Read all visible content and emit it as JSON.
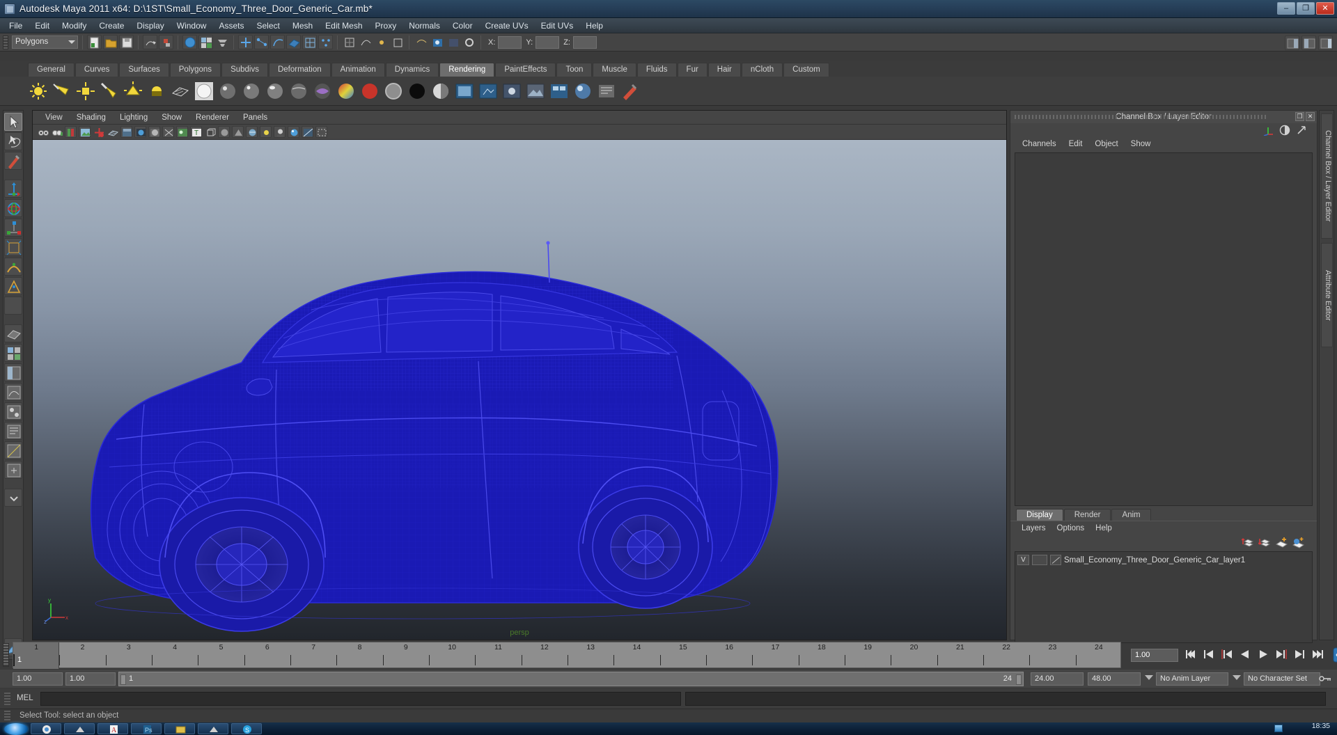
{
  "window": {
    "title": "Autodesk Maya 2011 x64: D:\\1ST\\Small_Economy_Three_Door_Generic_Car.mb*",
    "minimize": "–",
    "maximize": "❐",
    "close": "✕"
  },
  "menubar": {
    "items": [
      "File",
      "Edit",
      "Modify",
      "Create",
      "Display",
      "Window",
      "Assets",
      "Select",
      "Mesh",
      "Edit Mesh",
      "Proxy",
      "Normals",
      "Color",
      "Create UVs",
      "Edit UVs",
      "Help"
    ]
  },
  "statusline": {
    "mode": "Polygons",
    "x_label": "X:",
    "y_label": "Y:",
    "z_label": "Z:",
    "x_value": "",
    "y_value": "",
    "z_value": ""
  },
  "shelf": {
    "tabs": [
      "General",
      "Curves",
      "Surfaces",
      "Polygons",
      "Subdivs",
      "Deformation",
      "Animation",
      "Dynamics",
      "Rendering",
      "PaintEffects",
      "Toon",
      "Muscle",
      "Fluids",
      "Fur",
      "Hair",
      "nCloth",
      "Custom"
    ],
    "active_tab": "Rendering",
    "icons": [
      "ambient-light-icon",
      "directional-light-icon",
      "point-light-icon",
      "spot-light-icon",
      "area-light-icon",
      "volume-light-icon",
      "plane-light-icon",
      "lambert-material-icon",
      "blinn-material-icon",
      "phong-material-icon",
      "phonge-material-icon",
      "anisotropic-material-icon",
      "layered-shader-icon",
      "ramp-shader-icon",
      "surface-shader-icon",
      "use-background-icon",
      "black-shader-icon",
      "shading-map-icon",
      "render-current-frame-icon",
      "ipr-render-icon",
      "render-settings-icon",
      "render-view-icon",
      "batch-render-icon",
      "hypershade-icon",
      "rendering-flags-icon",
      "paint-icon"
    ]
  },
  "toolbox": {
    "tools": [
      "select-tool",
      "lasso-select-tool",
      "paint-select-tool",
      "move-tool",
      "rotate-tool",
      "scale-tool",
      "universal-manipulator-tool",
      "soft-modification-tool",
      "show-manipulator-tool",
      "last-tool-used",
      "quick-layout-single-icon",
      "quick-layout-four-icon",
      "quick-layout-persp-outliner-icon",
      "quick-layout-persp-graph-icon",
      "quick-layout-hypershade-icon",
      "quick-layout-outliner-icon",
      "quick-layout-uv-icon",
      "quick-layout-more-icon",
      "paint-effects-icon"
    ],
    "selected": "select-tool"
  },
  "viewport": {
    "menus": [
      "View",
      "Shading",
      "Lighting",
      "Show",
      "Renderer",
      "Panels"
    ],
    "icons": [
      "select-camera-icon",
      "lock-camera-icon",
      "bookmark-icon",
      "image-plane-icon",
      "keyframe-icon",
      "grid-icon",
      "film-gate-icon",
      "resolution-gate-icon",
      "gate-mask-icon",
      "xray-icon",
      "shadows-icon",
      "text-overlay-icon",
      "wireframe-icon",
      "smooth-shade-icon",
      "flat-shade-icon",
      "hardware-texture-icon",
      "light-icon",
      "shadow-icon",
      "hq-render-icon",
      "exposure-icon",
      "isolate-select-icon"
    ],
    "camera_label": "persp",
    "object_name": "Small_Economy_Three_Door_Generic_Car",
    "wireframe_color": "#1a1ab4",
    "axis": {
      "x": "x",
      "y": "y",
      "z": "z"
    }
  },
  "channelbox": {
    "title": "Channel Box / Layer Editor",
    "restore": "❐",
    "close": "✕",
    "menus": [
      "Channels",
      "Edit",
      "Object",
      "Show"
    ],
    "corner_icons": [
      "axis-toggle-icon",
      "channelbox-toggle-icon",
      "attribute-editor-icon"
    ],
    "content": ""
  },
  "layereditor": {
    "tabs": [
      "Display",
      "Render",
      "Anim"
    ],
    "active_tab": "Display",
    "menus": [
      "Layers",
      "Options",
      "Help"
    ],
    "buttons": [
      "move-layer-up-icon",
      "move-layer-down-icon",
      "new-layer-icon",
      "new-layer-from-selected-icon"
    ],
    "layers": [
      {
        "visible": "V",
        "state": "",
        "name": "Small_Economy_Three_Door_Generic_Car_layer1"
      }
    ]
  },
  "right_vtabs": [
    "Channel Box / Layer Editor",
    "Attribute Editor"
  ],
  "timeline": {
    "ticks": [
      "1",
      "2",
      "3",
      "4",
      "5",
      "6",
      "7",
      "8",
      "9",
      "10",
      "11",
      "12",
      "13",
      "14",
      "15",
      "16",
      "17",
      "18",
      "19",
      "20",
      "21",
      "22",
      "23",
      "24"
    ],
    "current_frame_marker": "1",
    "current_frame": "1.00"
  },
  "playback": {
    "buttons": [
      "go-to-start-icon",
      "step-back-frame-icon",
      "step-back-key-icon",
      "play-backwards-icon",
      "play-forwards-icon",
      "step-forward-key-icon",
      "step-forward-frame-icon",
      "go-to-end-icon"
    ],
    "auto_key_icon": "auto-key-icon",
    "anim_prefs_icon": "animation-preferences-icon"
  },
  "range": {
    "anim_start": "1.00",
    "range_start": "1.00",
    "bar_start": "1",
    "bar_end": "24",
    "range_end": "24.00",
    "anim_end": "48.00",
    "anim_layer": "No Anim Layer",
    "character_set": "No Character Set"
  },
  "mel": {
    "label": "MEL",
    "input": "",
    "output": ""
  },
  "statusbar": {
    "help": "Select Tool: select an object"
  },
  "taskbar": {
    "start": "start-orb-icon",
    "items": [
      "chrome-icon",
      "maya-icon",
      "adobe-reader-icon",
      "photoshop-icon",
      "winrar-icon",
      "maya-2-icon",
      "skype-icon"
    ],
    "time": "18:35"
  }
}
